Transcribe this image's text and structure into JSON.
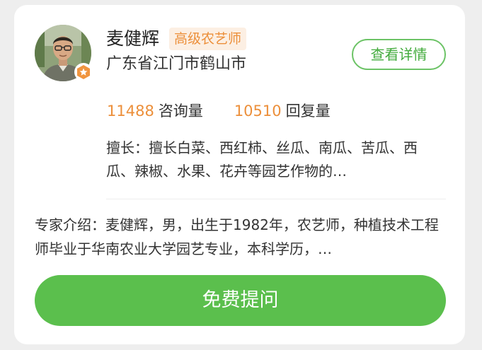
{
  "expert": {
    "name": "麦健辉",
    "title_badge": "高级农艺师",
    "location": "广东省江门市鹤山市",
    "avatar_icon": "person-photo",
    "verified_icon": "star-badge-icon",
    "verified_color": "#f0953f"
  },
  "actions": {
    "view_details_label": "查看详情",
    "ask_free_label": "免费提问"
  },
  "stats": {
    "consult_count": "11488",
    "consult_label": "咨询量",
    "reply_count": "10510",
    "reply_label": "回复量"
  },
  "specialty": "擅长：擅长白菜、西红柿、丝瓜、南瓜、苦瓜、西瓜、辣椒、水果、花卉等园艺作物的…",
  "intro": "专家介绍：麦健辉，男，出生于1982年，农艺师，种植技术工程师毕业于华南农业大学园艺专业，本科学历，…",
  "colors": {
    "accent_green": "#5bbf4d",
    "outline_green": "#6cc366",
    "orange": "#ec8f3a",
    "badge_bg": "#fcefe3"
  }
}
